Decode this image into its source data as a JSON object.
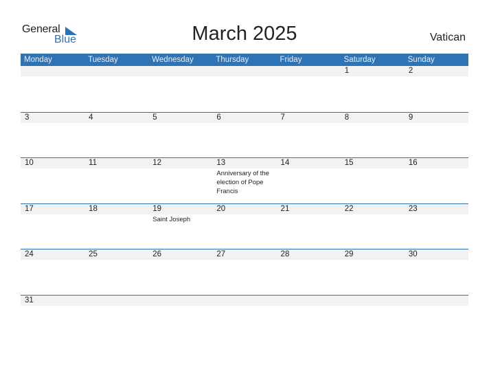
{
  "logo": {
    "general": "General",
    "blue": "Blue",
    "accent_color": "#2b72b8"
  },
  "title": "March 2025",
  "country": "Vatican",
  "weekdays": [
    "Monday",
    "Tuesday",
    "Wednesday",
    "Thursday",
    "Friday",
    "Saturday",
    "Sunday"
  ],
  "weeks": [
    [
      {
        "day": ""
      },
      {
        "day": ""
      },
      {
        "day": ""
      },
      {
        "day": ""
      },
      {
        "day": ""
      },
      {
        "day": "1"
      },
      {
        "day": "2"
      }
    ],
    [
      {
        "day": "3"
      },
      {
        "day": "4"
      },
      {
        "day": "5"
      },
      {
        "day": "6"
      },
      {
        "day": "7"
      },
      {
        "day": "8"
      },
      {
        "day": "9"
      }
    ],
    [
      {
        "day": "10"
      },
      {
        "day": "11"
      },
      {
        "day": "12"
      },
      {
        "day": "13",
        "event": "Anniversary of the election of Pope Francis"
      },
      {
        "day": "14"
      },
      {
        "day": "15"
      },
      {
        "day": "16"
      }
    ],
    [
      {
        "day": "17"
      },
      {
        "day": "18"
      },
      {
        "day": "19",
        "event": "Saint Joseph"
      },
      {
        "day": "20"
      },
      {
        "day": "21"
      },
      {
        "day": "22"
      },
      {
        "day": "23"
      }
    ],
    [
      {
        "day": "24"
      },
      {
        "day": "25"
      },
      {
        "day": "26"
      },
      {
        "day": "27"
      },
      {
        "day": "28"
      },
      {
        "day": "29"
      },
      {
        "day": "30"
      }
    ],
    [
      {
        "day": "31"
      },
      {
        "day": ""
      },
      {
        "day": ""
      },
      {
        "day": ""
      },
      {
        "day": ""
      },
      {
        "day": ""
      },
      {
        "day": ""
      }
    ]
  ],
  "colors": {
    "header_bg": "#2e74b5",
    "date_strip": "#f2f2f2"
  }
}
